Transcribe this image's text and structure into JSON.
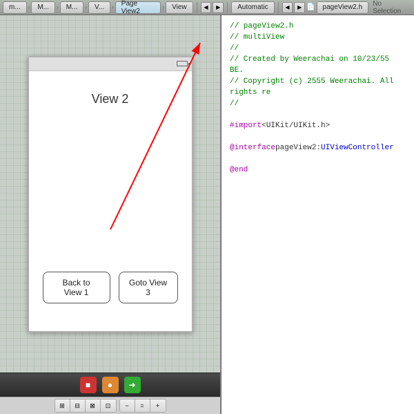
{
  "toolbar": {
    "back_btn": "◀",
    "forward_btn": "▶",
    "mode_btn": "Automatic",
    "breadcrumbs": [
      "m...",
      "M...",
      "M...",
      "V...",
      "Page View2",
      "View"
    ],
    "no_selection": "No Selection",
    "file_name": "pageView2.h"
  },
  "canvas": {
    "view_title": "View 2",
    "btn_back": "Back to View 1",
    "btn_goto": "Goto View 3"
  },
  "code": {
    "lines": [
      {
        "type": "comment",
        "text": "//  pageView2.h"
      },
      {
        "type": "comment",
        "text": "//  multiView"
      },
      {
        "type": "comment",
        "text": "//"
      },
      {
        "type": "comment",
        "text": "//  Created by Weerachai on 10/23/55 BE."
      },
      {
        "type": "comment",
        "text": "//  Copyright (c) 2555 Weerachai. All rights re"
      },
      {
        "type": "comment",
        "text": "//"
      },
      {
        "type": "blank",
        "text": ""
      },
      {
        "type": "import",
        "keyword": "#import",
        "text": " <UIKit/UIKit.h>"
      },
      {
        "type": "blank",
        "text": ""
      },
      {
        "type": "interface",
        "keyword1": "@interface",
        "name": " pageView2",
        "keyword2": " : ",
        "class": "UIViewController"
      },
      {
        "type": "blank",
        "text": ""
      },
      {
        "type": "end",
        "keyword": "@end"
      }
    ]
  },
  "bottom_toolbar": {
    "icons": [
      "🟥",
      "🟧",
      "🟩"
    ]
  }
}
